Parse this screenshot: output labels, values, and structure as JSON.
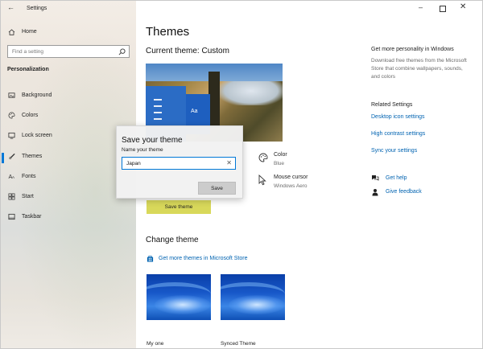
{
  "window": {
    "app_title": "Settings"
  },
  "sidebar": {
    "home_label": "Home",
    "search_placeholder": "Find a setting",
    "section_title": "Personalization",
    "items": [
      {
        "label": "Background",
        "icon": "image-icon"
      },
      {
        "label": "Colors",
        "icon": "palette-icon"
      },
      {
        "label": "Lock screen",
        "icon": "lock-screen-icon"
      },
      {
        "label": "Themes",
        "icon": "brush-icon",
        "selected": true
      },
      {
        "label": "Fonts",
        "icon": "font-icon"
      },
      {
        "label": "Start",
        "icon": "start-icon"
      },
      {
        "label": "Taskbar",
        "icon": "taskbar-icon"
      }
    ]
  },
  "main": {
    "title": "Themes",
    "current_theme": "Current theme: Custom",
    "preview_text": "Aa",
    "color": {
      "label": "Color",
      "value": "Blue"
    },
    "cursor": {
      "label": "Mouse cursor",
      "value": "Windows Aero"
    },
    "save_button": "Save theme",
    "change_theme": "Change theme",
    "store_link": "Get more themes in Microsoft Store",
    "themes": [
      {
        "label": "My one"
      },
      {
        "label": "Synced Theme"
      }
    ]
  },
  "right": {
    "heading": "Get more personality in Windows",
    "description": "Download free themes from the Microsoft Store that combine wallpapers, sounds, and colors",
    "related_title": "Related Settings",
    "related_links": [
      "Desktop icon settings",
      "High contrast settings",
      "Sync your settings"
    ],
    "help": "Get help",
    "feedback": "Give feedback"
  },
  "dialog": {
    "title": "Save your theme",
    "subtitle": "Name your theme",
    "input_value": "Japan",
    "save_label": "Save"
  },
  "colors": {
    "accent": "#0078d7",
    "link": "#0063b1",
    "save_highlight": "#d8d85a"
  }
}
